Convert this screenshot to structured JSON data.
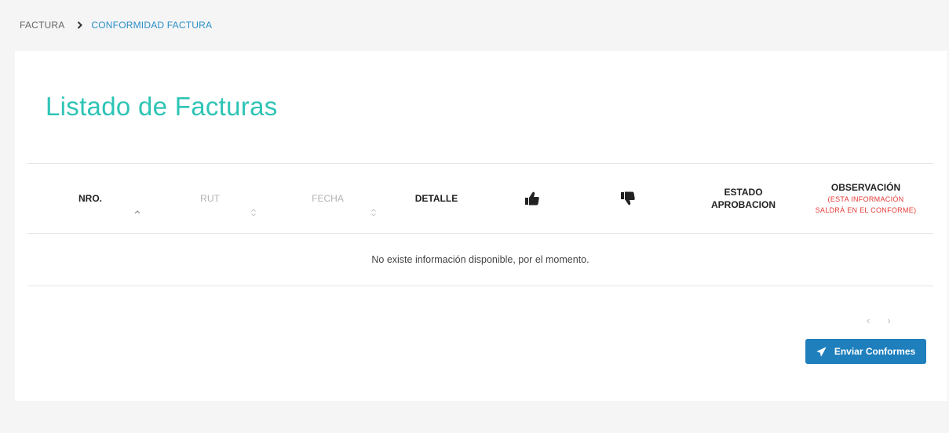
{
  "breadcrumb": {
    "root": "FACTURA",
    "current": "CONFORMIDAD FACTURA"
  },
  "page": {
    "title": "Listado de Facturas"
  },
  "table": {
    "columns": {
      "nro": "NRO.",
      "rut": "RUT",
      "fecha": "FECHA",
      "detalle": "DETALLE",
      "approve_icon": "thumbs-up-icon",
      "reject_icon": "thumbs-down-icon",
      "estado_line1": "ESTADO",
      "estado_line2": "APROBACION",
      "observacion": "OBSERVACIÓN",
      "observacion_note_1": "(ESTA INFORMACIÓN",
      "observacion_note_2": "SALDRÁ EN EL CONFORME)"
    },
    "empty_message": "No existe información disponible, por el momento."
  },
  "pagination": {
    "prev": "‹",
    "next": "›"
  },
  "actions": {
    "send_label": "Enviar Conformes",
    "send_icon": "paper-plane-icon"
  },
  "colors": {
    "title": "#2ec4b6",
    "accent": "#1f7fbd",
    "link": "#2b8fc6",
    "warning_text": "#e53935"
  }
}
